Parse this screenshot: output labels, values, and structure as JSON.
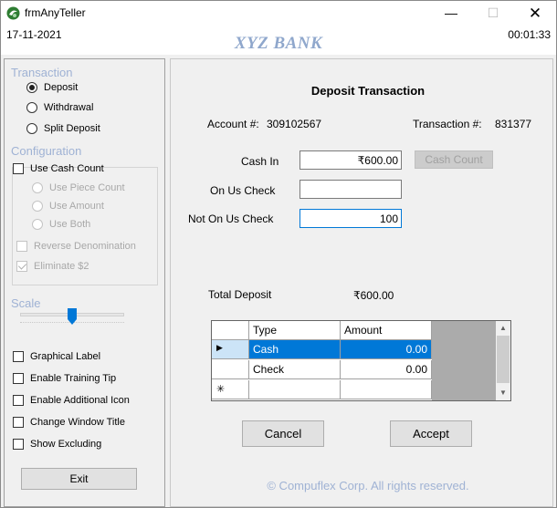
{
  "window": {
    "title": "frmAnyTeller",
    "minimize": "—",
    "maximize": "☐",
    "close": "✕"
  },
  "header": {
    "date": "17-11-2021",
    "bank_name": "XYZ BANK",
    "time": "00:01:33"
  },
  "sidebar": {
    "transaction_label": "Transaction",
    "transaction_options": [
      {
        "label": "Deposit",
        "selected": true
      },
      {
        "label": "Withdrawal",
        "selected": false
      },
      {
        "label": "Split Deposit",
        "selected": false
      }
    ],
    "configuration_label": "Configuration",
    "use_cash_count": "Use Cash Count",
    "cash_count_options": [
      "Use Piece Count",
      "Use Amount",
      "Use Both"
    ],
    "reverse_denomination": "Reverse Denomination",
    "eliminate_two": "Eliminate $2",
    "scale_label": "Scale",
    "scale_value": 0.5,
    "checks": [
      "Graphical Label",
      "Enable Training Tip",
      "Enable Additional Icon",
      "Change Window Title",
      "Show Excluding"
    ],
    "exit_label": "Exit"
  },
  "main": {
    "title": "Deposit Transaction",
    "account_label": "Account #:",
    "account_value": "309102567",
    "transaction_label": "Transaction #:",
    "transaction_value": "831377",
    "cash_in_label": "Cash In",
    "cash_in_value": "₹600.00",
    "cash_count_button": "Cash Count",
    "on_us_label": "On Us Check",
    "on_us_value": "",
    "not_on_us_label": "Not On Us Check",
    "not_on_us_value": "100",
    "total_label": "Total Deposit",
    "total_value": "₹600.00",
    "grid": {
      "headers": [
        "Type",
        "Amount"
      ],
      "rows": [
        {
          "type": "Cash",
          "amount": "0.00"
        },
        {
          "type": "Check",
          "amount": "0.00"
        }
      ],
      "new_row_marker": "✳"
    },
    "cancel": "Cancel",
    "accept": "Accept",
    "footer": "© Compuflex Corp. All rights reserved."
  },
  "colors": {
    "accent_text": "#9fb2d4",
    "selection": "#0078d7",
    "slider_thumb": "#0078d7"
  }
}
